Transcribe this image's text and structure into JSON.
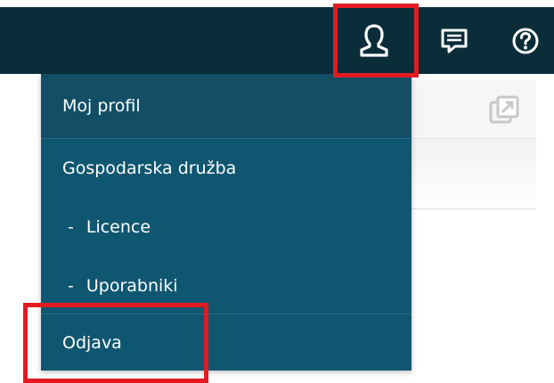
{
  "menu": {
    "items": [
      {
        "label": "Moj profil",
        "dash": ""
      },
      {
        "label": "Gospodarska družba",
        "dash": ""
      },
      {
        "label": "Licence",
        "dash": "-"
      },
      {
        "label": "Uporabniki",
        "dash": "-"
      },
      {
        "label": "Odjava",
        "dash": ""
      }
    ]
  },
  "icons": {
    "user": "user-icon",
    "messages": "message-icon",
    "help": "help-icon",
    "popout": "popout-icon"
  },
  "colors": {
    "topbar": "#0b2d3a",
    "menu_bg": "#0f5670",
    "highlight": "#e21b23",
    "text": "#ffffff"
  }
}
